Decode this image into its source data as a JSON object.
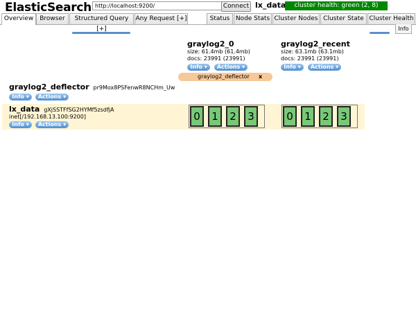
{
  "header": {
    "app_title": "ElasticSearch",
    "url": "http://localhost:9200/",
    "connect_label": "Connect",
    "cluster_name": "lx_data",
    "health_text": "cluster health: green (2, 8)",
    "health_color": "#008800"
  },
  "tabs_left": [
    "Overview",
    "Browser",
    "Structured Query [+]",
    "Any Request [+]"
  ],
  "tabs_right": [
    "Status",
    "Node Stats",
    "Cluster Nodes",
    "Cluster State",
    "Cluster Health"
  ],
  "info_tab": "Info",
  "indices": [
    {
      "name": "graylog2_0",
      "size": "size: 61.4mb (61.4mb)",
      "docs": "docs: 23991 (23991)"
    },
    {
      "name": "graylog2_recent",
      "size": "size: 63.1mb (63.1mb)",
      "docs": "docs: 23991 (23991)"
    }
  ],
  "buttons": {
    "info": "Info ▾",
    "actions": "Actions ▾"
  },
  "alias": {
    "name": "graylog2_deflector",
    "close": "x"
  },
  "alias_row": {
    "name": "graylog2_deflector",
    "id": "pr9Mox8PSFenwR8NCHm_Uw"
  },
  "node": {
    "name": "lx_data",
    "id": "gXjSSTFfSG2HYMf5zsdfjA",
    "address": "inet[/192.168.13.100:9200]"
  },
  "shards": [
    {
      "group": "graylog2_0",
      "labels": [
        "0",
        "1",
        "2",
        "3"
      ]
    },
    {
      "group": "graylog2_recent",
      "labels": [
        "0",
        "1",
        "2",
        "3"
      ]
    }
  ],
  "colors": {
    "shard_fill": "#78c878",
    "node_band": "#fff5d4",
    "alias_fill": "#f7c898",
    "button": "#4d8fd2"
  }
}
